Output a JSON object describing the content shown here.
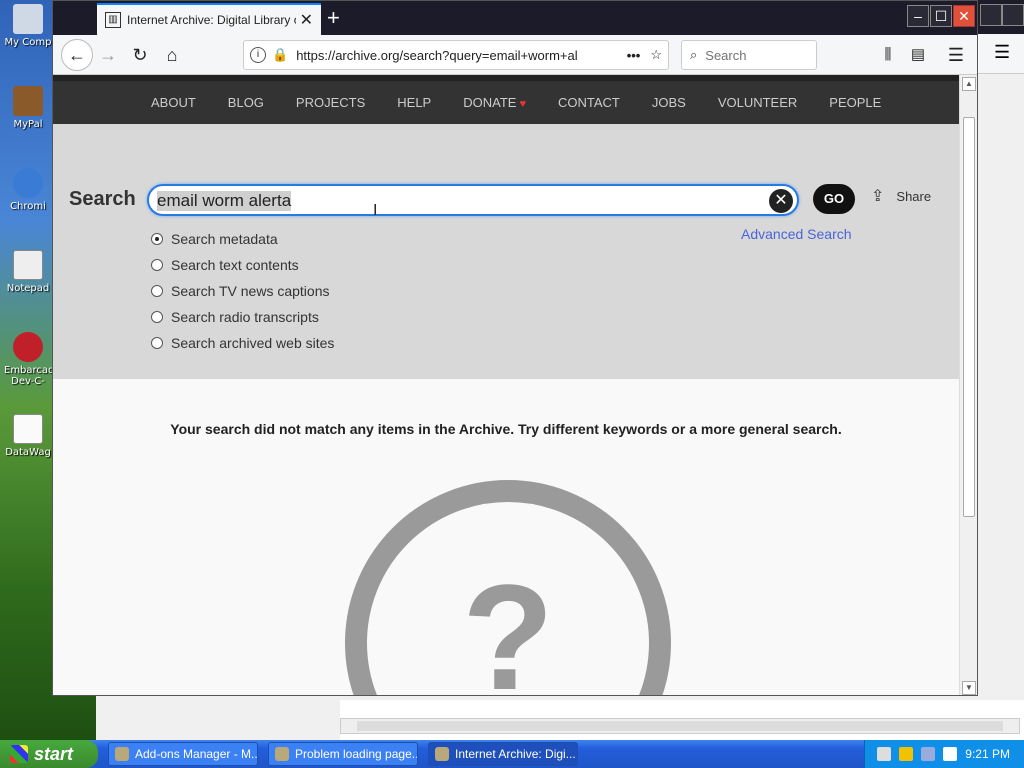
{
  "desktop": {
    "icons": [
      {
        "label": "My Comp"
      },
      {
        "label": "MyPal"
      },
      {
        "label": "Chromi"
      },
      {
        "label": "Notepad"
      },
      {
        "label": "Embarcad Dev-C-"
      },
      {
        "label": "DataWag"
      }
    ]
  },
  "browser": {
    "tab_title": "Internet Archive: Digital Library of",
    "tab_close": "✕",
    "new_tab": "+",
    "window_controls": {
      "minimize": "–",
      "maximize": "☐",
      "close": "✕"
    },
    "url": "https://archive.org/search?query=email+worm+al",
    "search_placeholder": "Search",
    "icons": [
      "back-icon",
      "forward-icon",
      "reload-icon",
      "home-icon",
      "info-icon",
      "lock-icon",
      "page-actions-icon",
      "bookmark-star-icon",
      "library-icon",
      "sidebar-icon",
      "menu-icon"
    ]
  },
  "site": {
    "nav": [
      "ABOUT",
      "BLOG",
      "PROJECTS",
      "HELP",
      "DONATE",
      "CONTACT",
      "JOBS",
      "VOLUNTEER",
      "PEOPLE"
    ],
    "search_label": "Search",
    "search_value": "email worm alerta",
    "go_label": "GO",
    "share_label": "Share",
    "advanced_search": "Advanced Search",
    "options": [
      {
        "label": "Search metadata",
        "selected": true
      },
      {
        "label": "Search text contents",
        "selected": false
      },
      {
        "label": "Search TV news captions",
        "selected": false
      },
      {
        "label": "Search radio transcripts",
        "selected": false
      },
      {
        "label": "Search archived web sites",
        "selected": false
      }
    ],
    "no_match": "Your search did not match any items in the Archive. Try different keywords or a more general search.",
    "question_mark": "?"
  },
  "taskbar": {
    "start_label": "start",
    "buttons": [
      {
        "label": "Add-ons Manager - M...",
        "active": false
      },
      {
        "label": "Problem loading page...",
        "active": false
      },
      {
        "label": "Internet Archive: Digi...",
        "active": true
      }
    ],
    "clock": "9:21 PM"
  },
  "colors": {
    "accent": "#2a7ae2",
    "link": "#4b64d7",
    "nav_bg": "#333333",
    "taskbar": "#245edb"
  }
}
